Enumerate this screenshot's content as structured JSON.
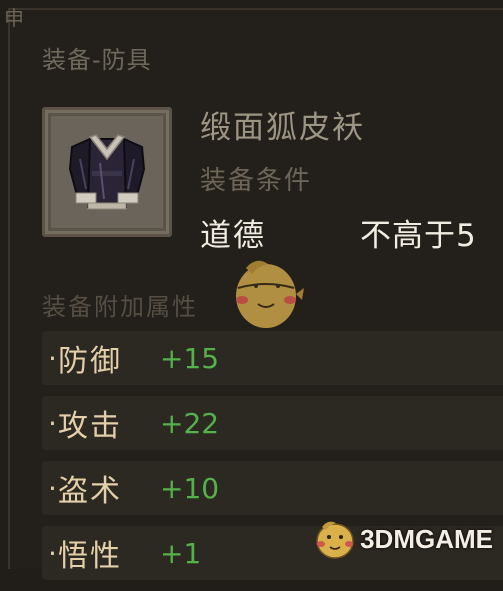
{
  "panel": {
    "corner_glyph": "申",
    "category": "装备-防具"
  },
  "item": {
    "icon": "robe-icon",
    "name": "缎面狐皮袄",
    "condition_title": "装备条件",
    "condition_key": "道德",
    "condition_value": "不高于5"
  },
  "attributes": {
    "title": "装备附加属性",
    "bullet": "·",
    "items": [
      {
        "name": "防御",
        "value": "+15"
      },
      {
        "name": "攻击",
        "value": "+22"
      },
      {
        "name": "盗术",
        "value": "+10"
      },
      {
        "name": "悟性",
        "value": "+1"
      }
    ]
  },
  "watermark": {
    "text": "3DMGAME"
  },
  "colors": {
    "background": "#231f1a",
    "attr_name": "#e3cfa8",
    "attr_value": "#55b24a",
    "condition_text": "#f1ece2"
  }
}
